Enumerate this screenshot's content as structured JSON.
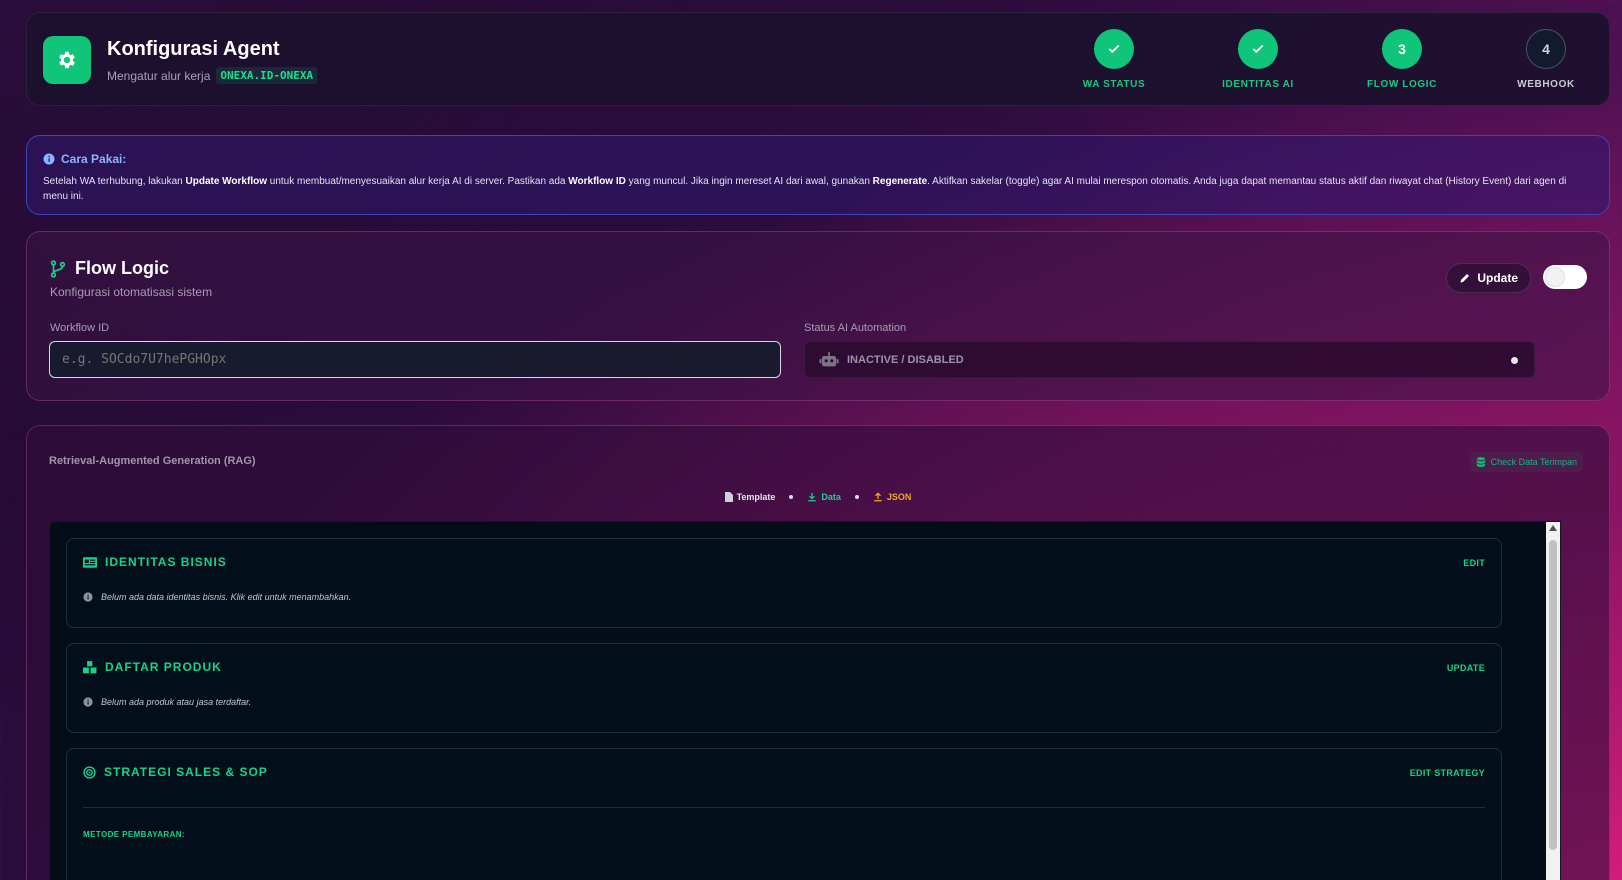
{
  "header": {
    "title": "Konfigurasi Agent",
    "subtitle": "Mengatur alur kerja",
    "agent_code": "ONEXA.ID-ONEXA",
    "steps": [
      {
        "number": "",
        "label": "WA STATUS",
        "state": "done"
      },
      {
        "number": "",
        "label": "IDENTITAS AI",
        "state": "done"
      },
      {
        "number": "3",
        "label": "FLOW LOGIC",
        "state": "active"
      },
      {
        "number": "4",
        "label": "WEBHOOK",
        "state": "pending"
      }
    ]
  },
  "info": {
    "title": "Cara Pakai:",
    "p1": "Setelah WA terhubung, lakukan ",
    "b1": "Update Workflow",
    "p2": " untuk membuat/menyesuaikan alur kerja AI di server. Pastikan ada ",
    "b2": "Workflow ID",
    "p3": " yang muncul. Jika ingin mereset AI dari awal, gunakan ",
    "b3": "Regenerate",
    "p4": ". Aktifkan sakelar (toggle) agar AI mulai merespon otomatis. Anda juga dapat memantau status aktif dan riwayat chat (History Event) dari agen di menu ini."
  },
  "flow": {
    "title": "Flow Logic",
    "subtitle": "Konfigurasi otomatisasi sistem",
    "update_label": "Update",
    "workflow_label": "Workflow ID",
    "workflow_placeholder": "e.g. SOCdo7U7hePGHOpx",
    "status_label": "Status AI Automation",
    "status_value": "INACTIVE / DISABLED",
    "toggle_on": false
  },
  "rag": {
    "title": "Retrieval-Augmented Generation (RAG)",
    "check_label": "Check Data Terimpan",
    "tabs": {
      "template": "Template",
      "data": "Data",
      "json": "JSON"
    },
    "sections": {
      "identity": {
        "title": "IDENTITAS BISNIS",
        "action": "EDIT",
        "empty": "Belum ada data identitas bisnis. Klik edit untuk menambahkan."
      },
      "products": {
        "title": "DAFTAR PRODUK",
        "action": "UPDATE",
        "empty": "Belum ada produk atau jasa terdaftar."
      },
      "strategy": {
        "title": "STRATEGI SALES & SOP",
        "action": "EDIT STRATEGY",
        "sublabel": "METODE PEMBAYARAN:"
      }
    }
  },
  "colors": {
    "accent": "#10c47a",
    "info": "#8fb4ff",
    "json_tab": "#f5a623",
    "template_tab": "#e6e6ee"
  }
}
